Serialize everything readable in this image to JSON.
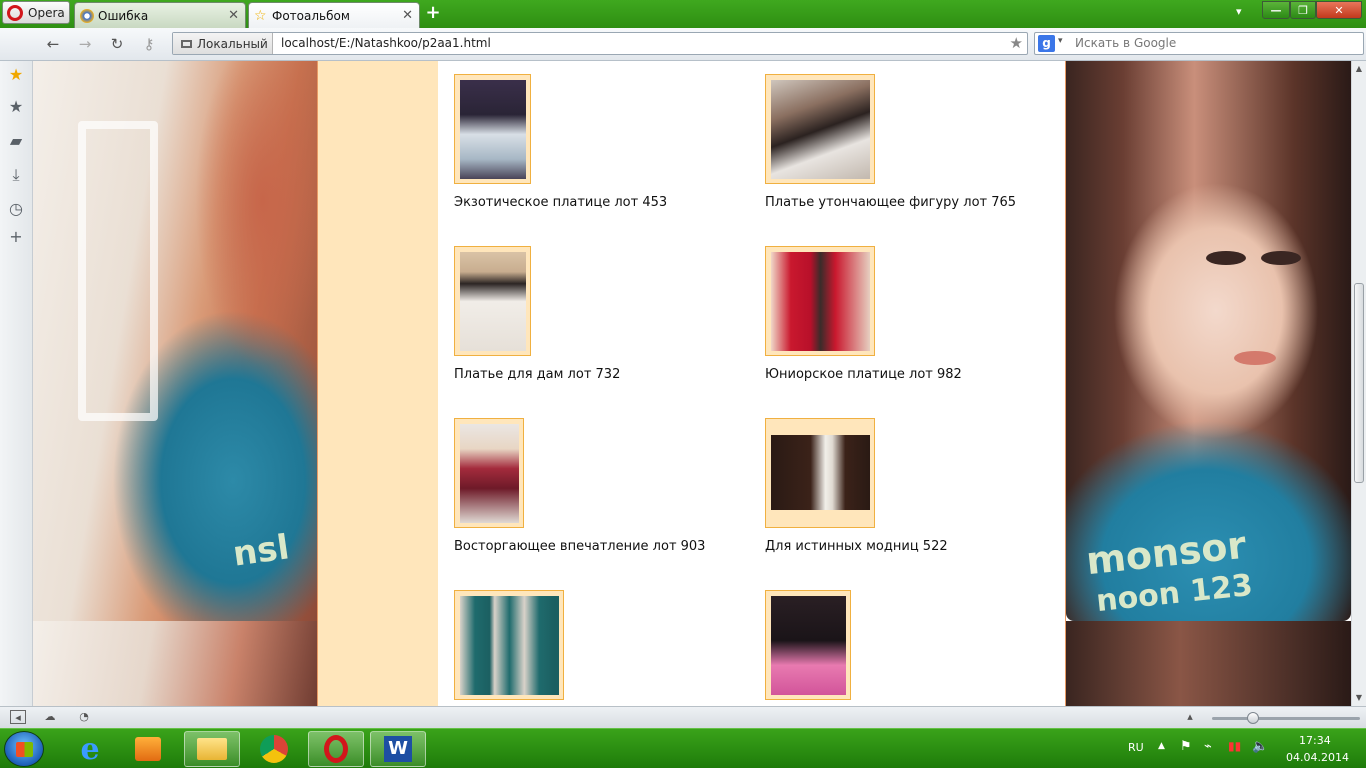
{
  "browser": {
    "menu_label": "Opera",
    "tabs": [
      {
        "title": "Ошибка",
        "active": false
      },
      {
        "title": "Фотоальбом",
        "active": true
      }
    ],
    "address": {
      "security_label": "Локальный",
      "url": "localhost/E:/Natashkoo/p2aa1.html"
    },
    "search": {
      "engine_icon": "g",
      "placeholder": "Искать в Google"
    }
  },
  "gallery": {
    "items": [
      {
        "caption": "Экзотическое платице лот 453"
      },
      {
        "caption": "Платье утончающее фигуру лот 765"
      },
      {
        "caption": "Платье для дам лот 732"
      },
      {
        "caption": "Юниорское платице лот 982"
      },
      {
        "caption": "Восторгающее впечатление лот 903"
      },
      {
        "caption": "Для истинных модниц 522"
      },
      {
        "caption": ""
      },
      {
        "caption": ""
      }
    ]
  },
  "taskbar": {
    "language": "RU",
    "time": "17:34",
    "date": "04.04.2014"
  },
  "colors": {
    "chrome_green": "#2e8f12",
    "page_column_bg": "#ffe6bb",
    "thumb_border": "#f0b040",
    "column_border": "#e89a64"
  }
}
